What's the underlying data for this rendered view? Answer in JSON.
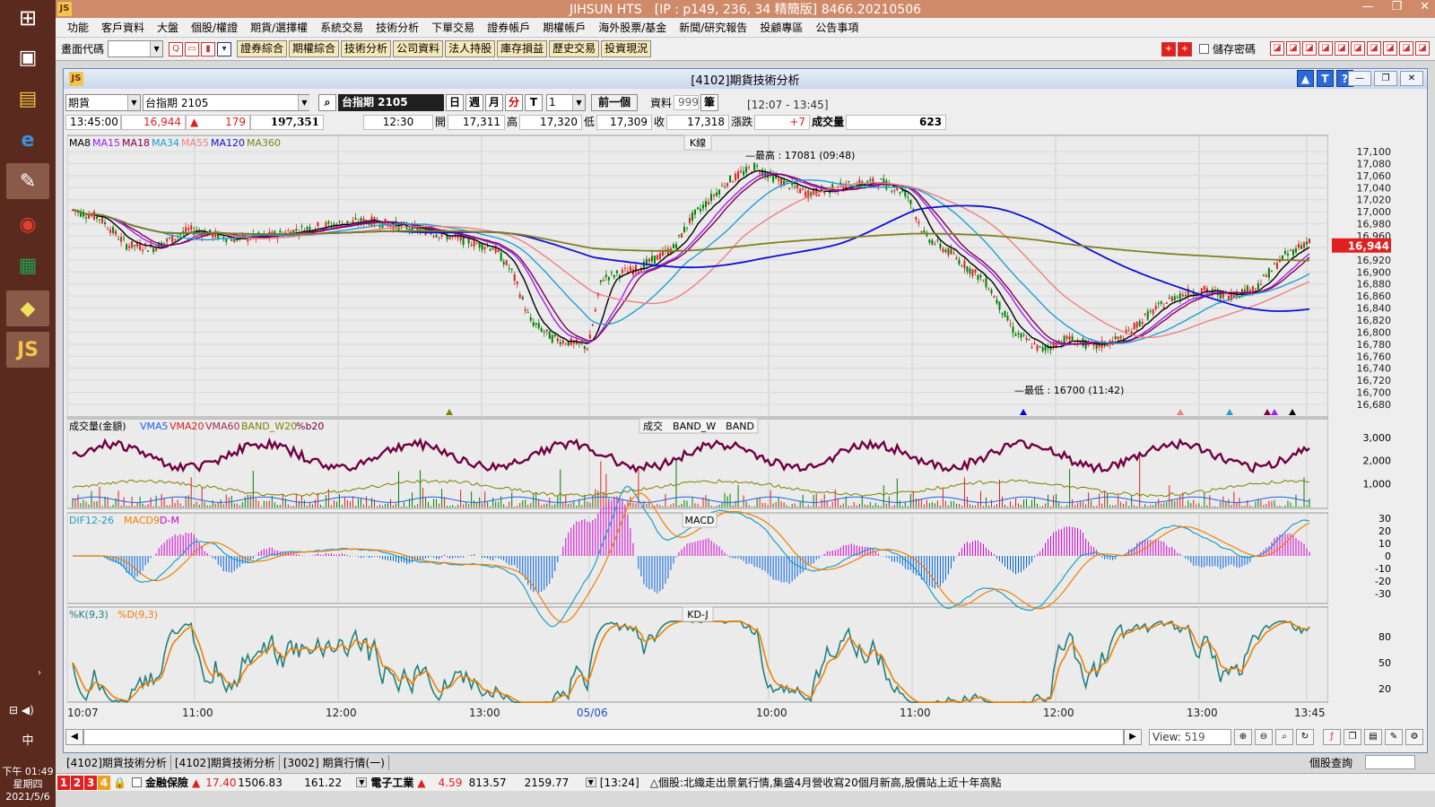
{
  "taskbar": {
    "clock_time": "下午 01:49",
    "clock_day": "星期四",
    "clock_date": "2021/5/6",
    "ime": "中"
  },
  "app": {
    "title": "JIHSUN HTS　[IP : p149, 236, 34 精簡版] 8466.20210506",
    "menu": [
      "功能",
      "客戶資料",
      "大盤",
      "個股/權證",
      "期貨/選擇權",
      "系統交易",
      "技術分析",
      "下單交易",
      "證券帳戶",
      "期權帳戶",
      "海外股票/基金",
      "新聞/研究報告",
      "投顧專區",
      "公告事項"
    ],
    "toolbar": {
      "code_label": "畫面代碼",
      "buttons": [
        "證券綜合",
        "期權綜合",
        "技術分析",
        "公司資料",
        "法人持股",
        "庫存損益",
        "歷史交易",
        "投資現況"
      ],
      "save_password_label": "儲存密碼"
    }
  },
  "window": {
    "title": "[4102]期貨技術分析",
    "market_select": "期貨",
    "symbol_select": "台指期 2105",
    "symbol_display": "台指期 2105",
    "period_buttons": [
      "日",
      "週",
      "月",
      "分",
      "T"
    ],
    "interval": "1",
    "prev_button": "前一個",
    "data_label": "資料",
    "data_count": "999",
    "unit_label": "筆",
    "time_range": "[12:07 - 13:45]"
  },
  "quote": {
    "time": "13:45:00",
    "price": "16,944",
    "change": "179",
    "volume_total": "197,351",
    "bar_time": "12:30",
    "open_label": "開",
    "open": "17,311",
    "high_label": "高",
    "high": "17,320",
    "low_label": "低",
    "low": "17,309",
    "close_label": "收",
    "close": "17,318",
    "chg_label": "漲跌",
    "chg": "+7",
    "vol_label": "成交量",
    "vol": "623"
  },
  "panels": {
    "kline_title": "K線",
    "ma_legend": [
      {
        "name": "MA8",
        "color": "#000000"
      },
      {
        "name": "MA15",
        "color": "#a020f0"
      },
      {
        "name": "MA18",
        "color": "#800050"
      },
      {
        "name": "MA34",
        "color": "#20a0d0"
      },
      {
        "name": "MA55",
        "color": "#f08080"
      },
      {
        "name": "MA120",
        "color": "#1010d0"
      },
      {
        "name": "MA360",
        "color": "#808020"
      }
    ],
    "high_note": "最高 : 17081 (09:48)",
    "low_note": "最低 : 16700 (11:42)",
    "price_ticks": [
      "17,100",
      "17,080",
      "17,060",
      "17,040",
      "17,020",
      "17,000",
      "16,980",
      "16,960",
      "16,940",
      "16,920",
      "16,900",
      "16,880",
      "16,860",
      "16,840",
      "16,820",
      "16,800",
      "16,780",
      "16,760",
      "16,740",
      "16,720",
      "16,700",
      "16,680"
    ],
    "current_price_tag": "16,944",
    "vol_title": "成交量(金額)",
    "vol_legend": [
      {
        "name": "VMA5",
        "color": "#2060f0"
      },
      {
        "name": "VMA20",
        "color": "#e02020"
      },
      {
        "name": "VMA60",
        "color": "#a03050"
      },
      {
        "name": "BAND_W20",
        "color": "#808000"
      },
      {
        "name": "%b20",
        "color": "#700040"
      }
    ],
    "vol_panel_tabs": "成交　BAND_W　BAND",
    "vol_ticks": [
      "3,000",
      "2,000",
      "1,000"
    ],
    "macd_legend": [
      {
        "name": "DIF12-26",
        "color": "#20a0c0"
      },
      {
        "name": "MACD9",
        "color": "#f08000"
      },
      {
        "name": "D-M",
        "color": "#d000d0"
      }
    ],
    "macd_title": "MACD",
    "macd_ticks": [
      "30",
      "20",
      "10",
      "0",
      "-10",
      "-20",
      "-30"
    ],
    "kd_legend": [
      {
        "name": "%K(9,3)",
        "color": "#208080"
      },
      {
        "name": "%D(9,3)",
        "color": "#f08000"
      }
    ],
    "kd_title": "KD-J",
    "kd_ticks": [
      "80",
      "50",
      "20"
    ],
    "time_labels": [
      "10:07",
      "11:00",
      "12:00",
      "13:00",
      "05/06",
      "10:00",
      "11:00",
      "12:00",
      "13:00",
      "13:45"
    ],
    "view_label": "View:",
    "view_value": "519"
  },
  "tabs": [
    "[4102]期貨技術分析",
    "[4102]期貨技術分析",
    "[3002] 期貨行情(一)"
  ],
  "stock_query": "個股查詢",
  "ticker": {
    "num_tabs": [
      "1",
      "2",
      "3",
      "4"
    ],
    "item1_name": "金融保險",
    "item1_price": "17.40",
    "item1_val": "1506.83",
    "item1_vol": "161.22",
    "item2_name": "電子工業",
    "item2_price": "4.59",
    "item2_val": "813.57",
    "item2_vol": "2159.77",
    "news": "[13:24]　△個股:北織走出景氣行情,集盛4月營收寫20個月新高,股價站上近十年高點"
  }
}
